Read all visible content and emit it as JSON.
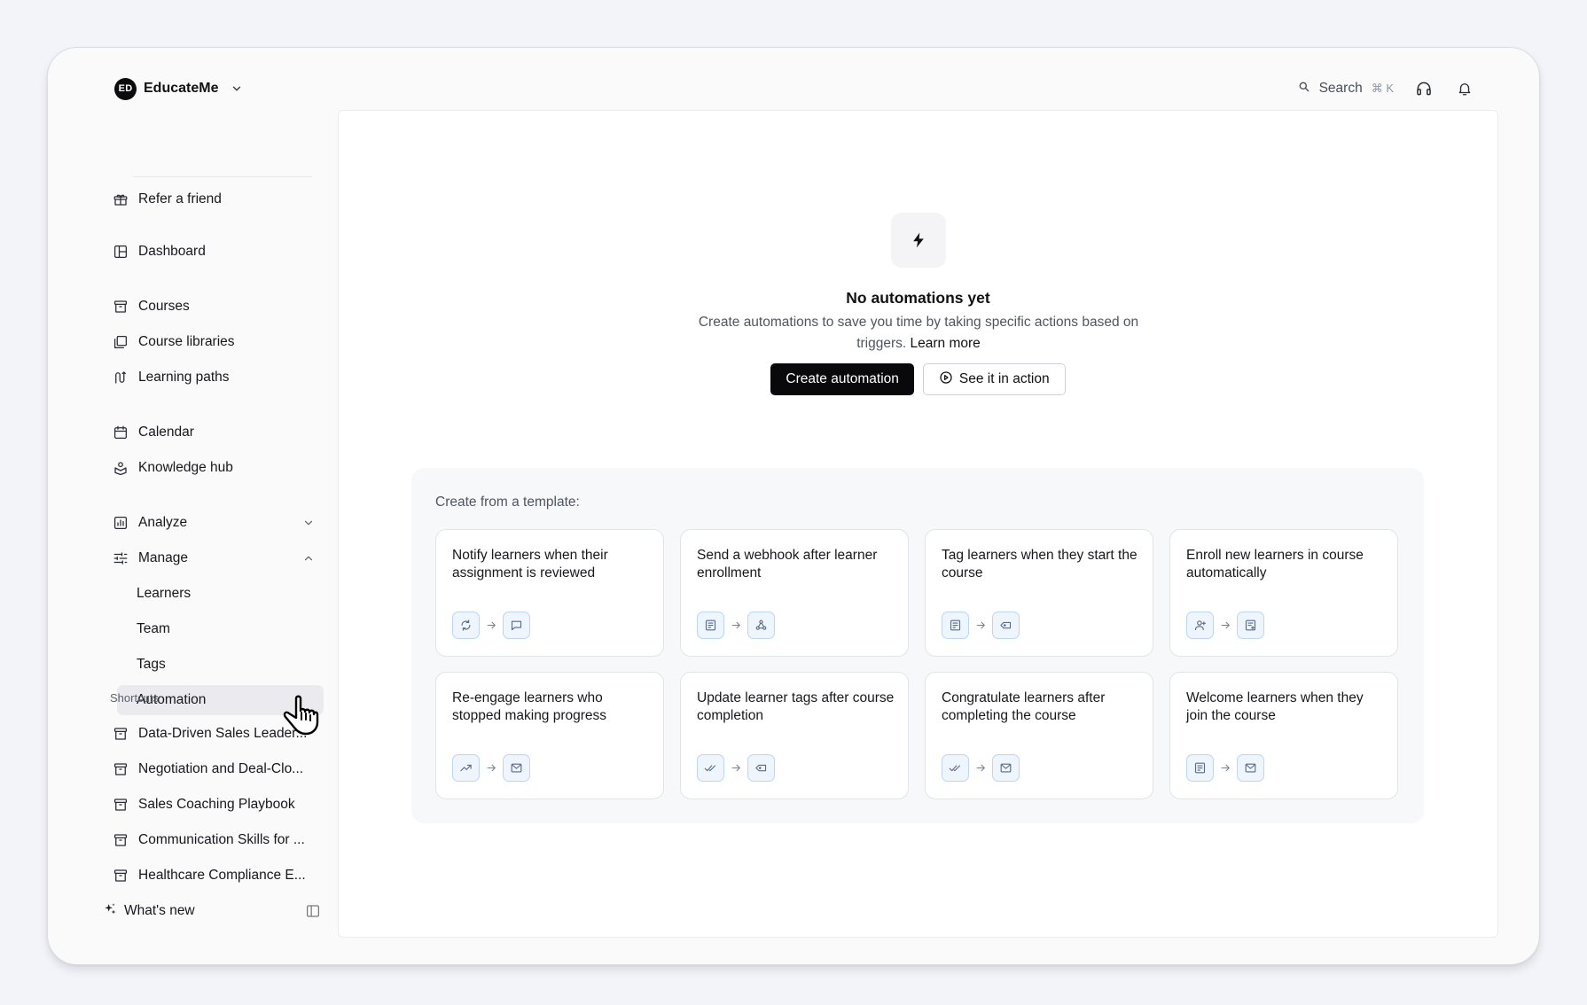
{
  "app": {
    "name": "EducateMe",
    "logo_text": "ED"
  },
  "topbar": {
    "search_label": "Search",
    "search_shortcut": "⌘ K",
    "support_icon": "headset-icon",
    "notifications_icon": "bell-icon"
  },
  "sidebar": {
    "refer": "Refer a friend",
    "dashboard": "Dashboard",
    "courses": "Courses",
    "course_libraries": "Course libraries",
    "learning_paths": "Learning paths",
    "calendar": "Calendar",
    "knowledge_hub": "Knowledge hub",
    "analyze": "Analyze",
    "manage": "Manage",
    "manage_items": [
      "Learners",
      "Team",
      "Tags",
      "Automation"
    ],
    "active_item": "Automation",
    "shortcuts_label": "Shortcuts",
    "shortcuts": [
      "Data-Driven Sales Leader...",
      "Negotiation and Deal-Clo...",
      "Sales Coaching Playbook",
      "Communication Skills for ...",
      "Healthcare Compliance E..."
    ],
    "whats_new": "What's new"
  },
  "empty_state": {
    "icon": "lightning-icon",
    "title": "No automations yet",
    "description": "Create automations to save you time by taking specific actions based on triggers.",
    "learn_more": "Learn more",
    "create_button": "Create automation",
    "demo_button": "See it in action"
  },
  "templates": {
    "label": "Create from a template:",
    "cards": [
      {
        "title": "Notify learners when their assignment is reviewed",
        "trigger": "refresh-icon",
        "action": "chat-icon"
      },
      {
        "title": "Send a webhook after learner enrollment",
        "trigger": "form-icon",
        "action": "webhook-icon"
      },
      {
        "title": "Tag learners when they start the course",
        "trigger": "form-icon",
        "action": "tag-icon"
      },
      {
        "title": "Enroll new learners in course automatically",
        "trigger": "user-add-icon",
        "action": "list-add-icon"
      },
      {
        "title": "Re-engage learners who stopped making progress",
        "trigger": "trending-icon",
        "action": "mail-icon"
      },
      {
        "title": "Update learner tags after course completion",
        "trigger": "double-check-icon",
        "action": "tag-icon"
      },
      {
        "title": "Congratulate learners after completing the course",
        "trigger": "double-check-icon",
        "action": "mail-icon"
      },
      {
        "title": "Welcome learners when they join the course",
        "trigger": "form-icon",
        "action": "mail-icon"
      }
    ]
  },
  "colors": {
    "primary_button": "#09090b",
    "active_nav_bg": "#ebebef",
    "flow_icon_bg": "#eef5fd",
    "flow_icon_border": "#bcd6f3",
    "flow_icon_stroke": "#5a6b85"
  }
}
